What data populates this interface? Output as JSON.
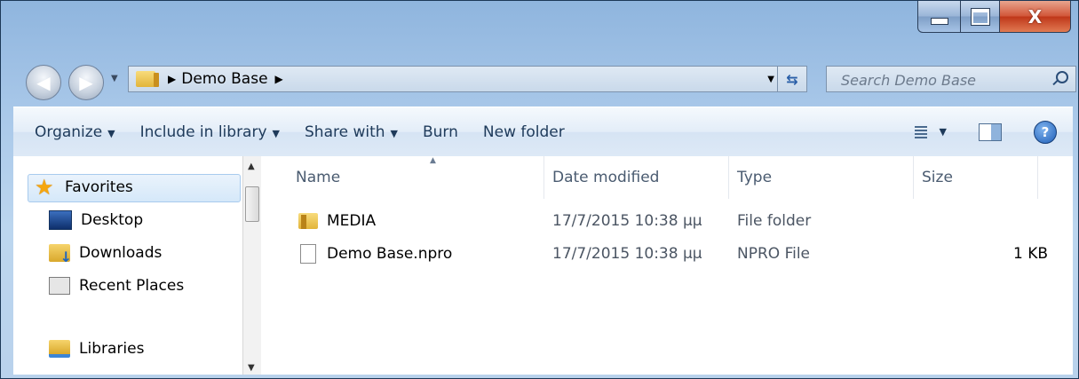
{
  "window": {
    "close_glyph": "X"
  },
  "address_bar": {
    "breadcrumb": "Demo Base",
    "search_placeholder": "Search Demo Base"
  },
  "toolbar": {
    "organize": "Organize",
    "include_in_library": "Include in library",
    "share_with": "Share with",
    "burn": "Burn",
    "new_folder": "New folder"
  },
  "nav_pane": {
    "favorites": "Favorites",
    "items": [
      {
        "label": "Desktop",
        "icon": "desktop-icon"
      },
      {
        "label": "Downloads",
        "icon": "downloads-folder-icon"
      },
      {
        "label": "Recent Places",
        "icon": "recent-places-icon"
      }
    ],
    "libraries": "Libraries"
  },
  "columns": {
    "name": "Name",
    "date_modified": "Date modified",
    "type": "Type",
    "size": "Size"
  },
  "files": [
    {
      "name": "MEDIA",
      "date": "17/7/2015 10:38 μμ",
      "type": "File folder",
      "size": "",
      "icon": "folder-icon"
    },
    {
      "name": "Demo Base.npro",
      "date": "17/7/2015 10:38 μμ",
      "type": "NPRO File",
      "size": "1 KB",
      "icon": "file-icon"
    }
  ],
  "colors": {
    "frame": "#a9c8e9",
    "close_button": "#c0381a",
    "toolbar_text": "#1e3a5a"
  }
}
